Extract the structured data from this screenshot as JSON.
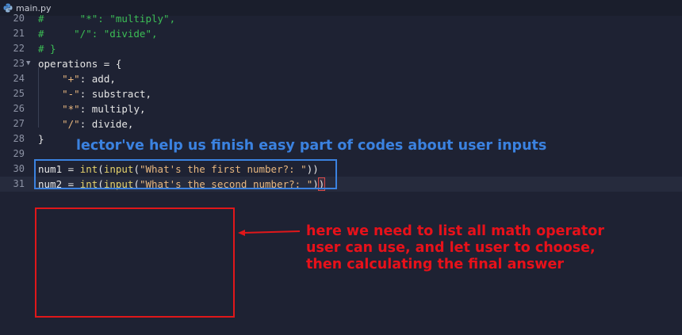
{
  "tab": {
    "filename": "main.py",
    "icon": "python-icon"
  },
  "editor": {
    "lines": [
      {
        "num": "20",
        "text": "#      \"*\": \"multiply\",",
        "kind": "comment"
      },
      {
        "num": "21",
        "text": "#     \"/\": \"divide\",",
        "kind": "comment"
      },
      {
        "num": "22",
        "text": "# }",
        "kind": "comment"
      },
      {
        "num": "23",
        "text": "operations = {",
        "kind": "code"
      },
      {
        "num": "24",
        "text": "    \"+\": add,",
        "kind": "code"
      },
      {
        "num": "25",
        "text": "    \"-\": substract,",
        "kind": "code"
      },
      {
        "num": "26",
        "text": "    \"*\": multiply,",
        "kind": "code"
      },
      {
        "num": "27",
        "text": "    \"/\": divide,",
        "kind": "code"
      },
      {
        "num": "28",
        "text": "}",
        "kind": "code"
      },
      {
        "num": "29",
        "text": "",
        "kind": "code"
      },
      {
        "num": "30",
        "text": "num1 = int(input(\"What's the first number?: \"))",
        "kind": "code"
      },
      {
        "num": "31",
        "text": "num2 = int(input(\"What's the second number?: \"))",
        "kind": "code"
      }
    ],
    "active_line": "31"
  },
  "annotations": {
    "blue_note": "lector've help us finish easy part of codes about user inputs",
    "red_note_lines": [
      "here we need to list all math operator",
      "user can use, and let user to choose,",
      "then calculating the final answer"
    ]
  },
  "colors": {
    "background": "#1e2233",
    "comment": "#3cbd55",
    "string": "#e8b77f",
    "function": "#e5d26b",
    "blue_annotation": "#3b82e0",
    "red_annotation": "#e8111a"
  }
}
